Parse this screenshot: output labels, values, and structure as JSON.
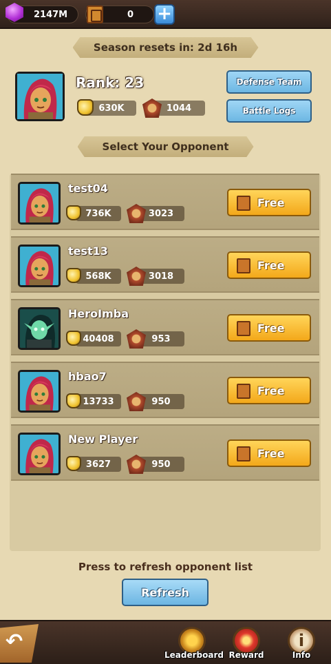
{
  "resources": {
    "gems": "2147M",
    "tickets": "0",
    "add_icon": "plus-icon"
  },
  "season": {
    "reset_text": "Season resets in: 2d 16h"
  },
  "player": {
    "rank_label": "Rank: 23",
    "power": "630K",
    "trophies": "1044"
  },
  "buttons": {
    "defense_team": "Defense Team",
    "battle_logs": "Battle Logs",
    "refresh": "Refresh"
  },
  "select_opponent_title": "Select Your Opponent",
  "opponents": [
    {
      "name": "test04",
      "power": "736K",
      "trophies": "3023",
      "action": "Free",
      "avatar": "red-hair-heroine"
    },
    {
      "name": "test13",
      "power": "568K",
      "trophies": "3018",
      "action": "Free",
      "avatar": "red-hair-heroine"
    },
    {
      "name": "HeroImba",
      "power": "40408",
      "trophies": "953",
      "action": "Free",
      "avatar": "green-elf-hero"
    },
    {
      "name": "hbao7",
      "power": "13733",
      "trophies": "950",
      "action": "Free",
      "avatar": "red-hair-heroine"
    },
    {
      "name": "New Player",
      "power": "3627",
      "trophies": "950",
      "action": "Free",
      "avatar": "red-hair-heroine"
    }
  ],
  "refresh_note": "Press to refresh opponent list",
  "bottom_nav": {
    "leaderboard": "Leaderboard",
    "reward": "Reward",
    "info": "Info"
  },
  "colors": {
    "background": "#e7d9b3",
    "free_button": "#f3a81a",
    "blue_button": "#6db7e3",
    "top_bar": "#3a2920"
  }
}
